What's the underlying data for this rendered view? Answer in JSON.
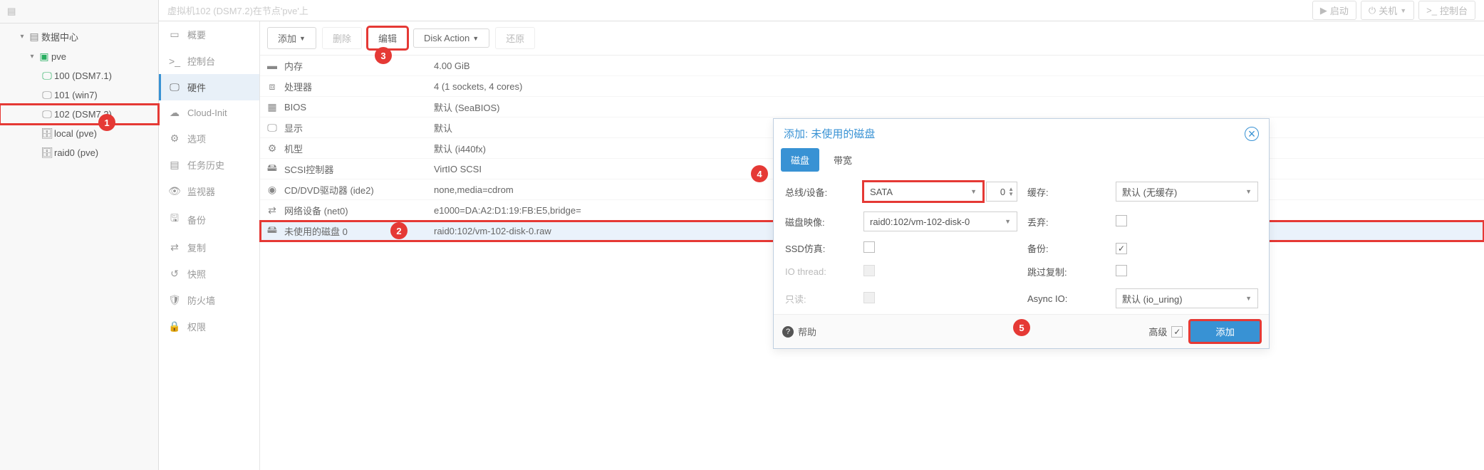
{
  "breadcrumb": {
    "title": "虚拟机102 (DSM7.2)在节点'pve'上",
    "start": "启动",
    "shutdown": "关机",
    "console": "控制台"
  },
  "tree": {
    "datacenter": "数据中心",
    "node": "pve",
    "vms": [
      "100 (DSM7.1)",
      "101 (win7)",
      "102 (DSM7.2)"
    ],
    "storages": [
      "local (pve)",
      "raid0 (pve)"
    ]
  },
  "sidetabs": {
    "summary": "概要",
    "console": "控制台",
    "hardware": "硬件",
    "cloudinit": "Cloud-Init",
    "options": "选项",
    "taskhistory": "任务历史",
    "monitor": "监视器",
    "backup": "备份",
    "replication": "复制",
    "snapshots": "快照",
    "firewall": "防火墙",
    "permissions": "权限"
  },
  "toolbar": {
    "add": "添加",
    "remove": "删除",
    "edit": "编辑",
    "diskaction": "Disk Action",
    "restore": "还原"
  },
  "hardware": [
    {
      "icon": "memory",
      "label": "内存",
      "value": "4.00 GiB"
    },
    {
      "icon": "cpu",
      "label": "处理器",
      "value": "4 (1 sockets, 4 cores)"
    },
    {
      "icon": "bios",
      "label": "BIOS",
      "value": "默认 (SeaBIOS)"
    },
    {
      "icon": "display",
      "label": "显示",
      "value": "默认"
    },
    {
      "icon": "machine",
      "label": "机型",
      "value": "默认 (i440fx)"
    },
    {
      "icon": "scsi",
      "label": "SCSI控制器",
      "value": "VirtIO SCSI"
    },
    {
      "icon": "cd",
      "label": "CD/DVD驱动器 (ide2)",
      "value": "none,media=cdrom"
    },
    {
      "icon": "net",
      "label": "网络设备 (net0)",
      "value": "e1000=DA:A2:D1:19:FB:E5,bridge="
    },
    {
      "icon": "hdd",
      "label": "未使用的磁盘 0",
      "value": "raid0:102/vm-102-disk-0.raw"
    }
  ],
  "dialog": {
    "title": "添加: 未使用的磁盘",
    "tabs": {
      "disk": "磁盘",
      "bandwidth": "带宽"
    },
    "labels": {
      "bus": "总线/设备:",
      "cache": "缓存:",
      "diskimage": "磁盘映像:",
      "discard": "丢弃:",
      "ssdemul": "SSD仿真:",
      "backup": "备份:",
      "iothread": "IO thread:",
      "skiprepl": "跳过复制:",
      "readonly": "只读:",
      "asyncio": "Async IO:"
    },
    "values": {
      "bus": "SATA",
      "busnum": "0",
      "cache": "默认 (无缓存)",
      "diskimage": "raid0:102/vm-102-disk-0",
      "asyncio": "默认 (io_uring)"
    },
    "footer": {
      "help": "帮助",
      "advanced": "高级",
      "submit": "添加"
    }
  },
  "callouts": {
    "c1": "1",
    "c2": "2",
    "c3": "3",
    "c4": "4",
    "c5": "5"
  }
}
